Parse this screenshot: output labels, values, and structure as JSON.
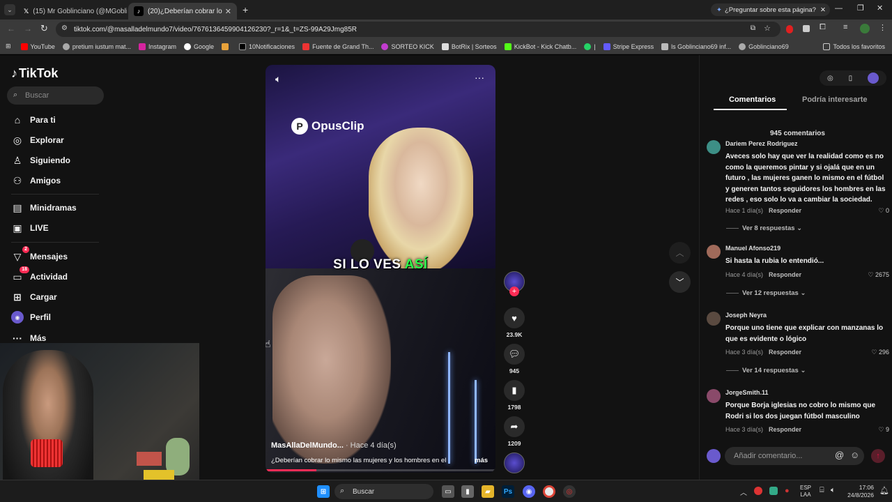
{
  "browser": {
    "tabs": [
      {
        "title": "(15) Mr Goblinciano (@MGoblin",
        "active": false
      },
      {
        "title": "(20)¿Deberían cobrar lo mismo",
        "active": true
      }
    ],
    "new_tab": "+",
    "ask_chip": "¿Preguntar sobre esta página?",
    "url": "tiktok.com/@masalladelmundo7/video/7676136459904126230?_r=1&_t=ZS-99A29Jmg85R",
    "bookmarks": [
      "YouTube",
      "pretium iustum mat...",
      "Instagram",
      "Google",
      "",
      "10Notificaciones",
      "Fuente de Grand Th...",
      "SORTEO KICK",
      "BotRix | Sorteos",
      "KickBot - Kick Chatb...",
      "|",
      "Stripe Express",
      "ls Goblinciano69 inf...",
      "Goblinciano69"
    ],
    "bookmarks_all": "Todos los favoritos"
  },
  "tiktok": {
    "logo": "TikTok",
    "search_placeholder": "Buscar",
    "nav": [
      {
        "label": "Para ti",
        "icon": "home-icon"
      },
      {
        "label": "Explorar",
        "icon": "compass-icon"
      },
      {
        "label": "Siguiendo",
        "icon": "following-icon"
      },
      {
        "label": "Amigos",
        "icon": "friends-icon"
      },
      {
        "label": "Minidramas",
        "icon": "minidramas-icon"
      },
      {
        "label": "LIVE",
        "icon": "live-icon"
      },
      {
        "label": "Mensajes",
        "icon": "messages-icon",
        "badge": "2"
      },
      {
        "label": "Actividad",
        "icon": "activity-icon",
        "badge": "18"
      },
      {
        "label": "Cargar",
        "icon": "upload-icon"
      },
      {
        "label": "Perfil",
        "icon": "avatar"
      },
      {
        "label": "Más",
        "icon": "more-icon"
      }
    ],
    "video": {
      "watermark": "OpusClip",
      "caption_part1": "SI LO VES ",
      "caption_part2": "ASÍ",
      "author": "MasAllaDelMundo...",
      "time": " · Hace 4 día(s)",
      "description": "¿Deberían cobrar lo mismo las mujeres y los hombres en el",
      "more": "más"
    },
    "actions": {
      "likes": "23.9K",
      "comments": "945",
      "saves": "1798",
      "shares": "1209"
    },
    "panel": {
      "tab_comments": "Comentarios",
      "tab_interest": "Podría interesarte",
      "count": "945 comentarios",
      "comments": [
        {
          "user": "Dariem Perez Rodriguez",
          "text": "Aveces solo hay que ver la realidad como es no como la queremos pintar y si ojalá que en un futuro , las mujeres ganen lo mismo en el fútbol y generen tantos seguidores los hombres en las redes , eso solo lo va a cambiar la sociedad.",
          "time": "Hace 1 día(s)",
          "reply": "Responder",
          "likes": "0",
          "replies": "Ver 8 respuestas"
        },
        {
          "user": "Manuel Afonso219",
          "text": "Si hasta la rubia lo entendió...",
          "time": "Hace 4 día(s)",
          "reply": "Responder",
          "likes": "2675",
          "replies": "Ver 12 respuestas"
        },
        {
          "user": "Joseph Neyra",
          "text": "Porque uno tiene que explicar con manzanas lo que es evidente o lógico",
          "time": "Hace 3 día(s)",
          "reply": "Responder",
          "likes": "296",
          "replies": "Ver 14 respuestas"
        },
        {
          "user": "JorgeSmith.11",
          "text": "Porque Borja iglesias no cobro lo mismo que Rodri si los dos juegan fútbol masculino",
          "time": "Hace 3 día(s)",
          "reply": "Responder",
          "likes": "9"
        }
      ],
      "add_comment_placeholder": "Añadir comentario..."
    }
  },
  "taskbar": {
    "search": "Buscar",
    "lang1": "ESP",
    "lang2": "LAA",
    "time": "17:06",
    "date": "24/8/2026"
  },
  "colors": {
    "accent": "#fe2c55",
    "caption_highlight": "#2cff4c"
  }
}
